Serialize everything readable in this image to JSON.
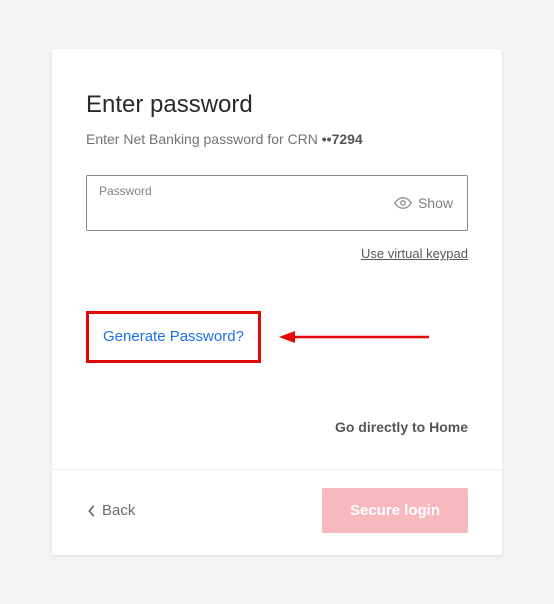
{
  "title": "Enter password",
  "subtitle_prefix": "Enter Net Banking password for CRN ",
  "crn_masked": "••7294",
  "input": {
    "label": "Password",
    "value": "",
    "show_label": "Show"
  },
  "virtual_keypad": "Use virtual keypad",
  "generate_password": "Generate Password?",
  "home_link": "Go directly to Home",
  "back_label": "Back",
  "secure_login": "Secure login"
}
